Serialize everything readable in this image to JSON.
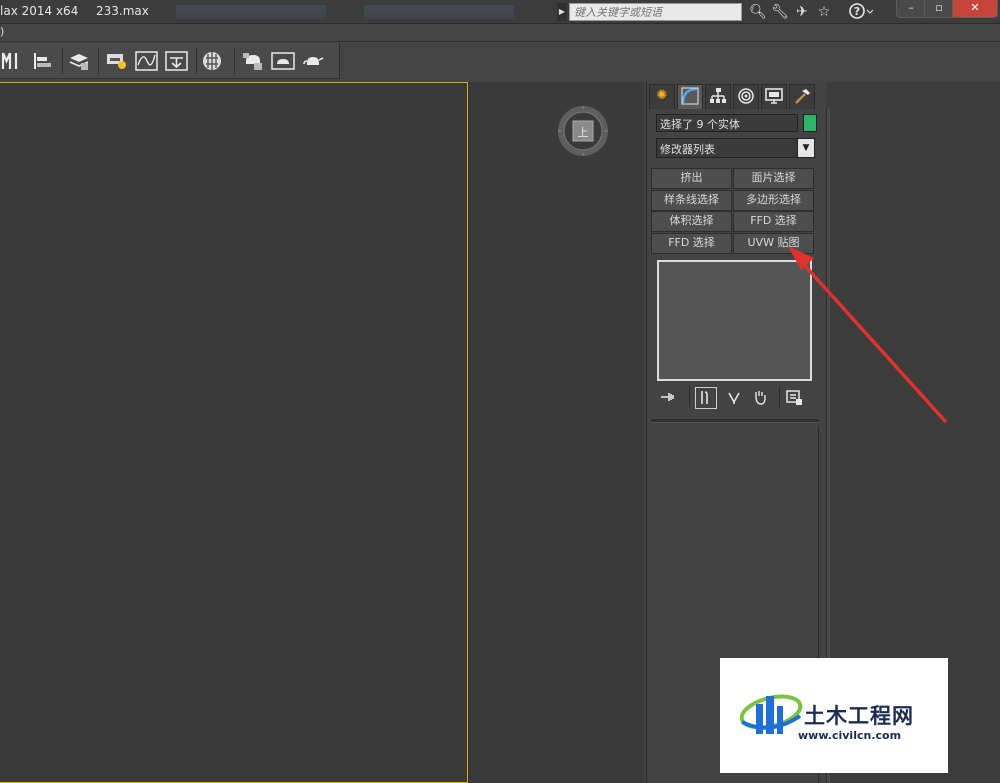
{
  "titlebar": {
    "app": "lax  2014 x64",
    "file": "233.max",
    "search_placeholder": "键入关键字或短语"
  },
  "menubar": {
    "partial": ")"
  },
  "command_panel": {
    "selection_text": "选择了 9 个实体",
    "selection_color": "#2fb36a",
    "modifier_list": "修改器列表",
    "buttons": [
      "挤出",
      "面片选择",
      "样条线选择",
      "多边形选择",
      "体积选择",
      "FFD 选择",
      "FFD 选择",
      "UVW 贴图"
    ]
  },
  "viewcube": {
    "face_label": "上"
  },
  "watermark": {
    "title": "土木工程网",
    "url": "www.civilcn.com"
  }
}
